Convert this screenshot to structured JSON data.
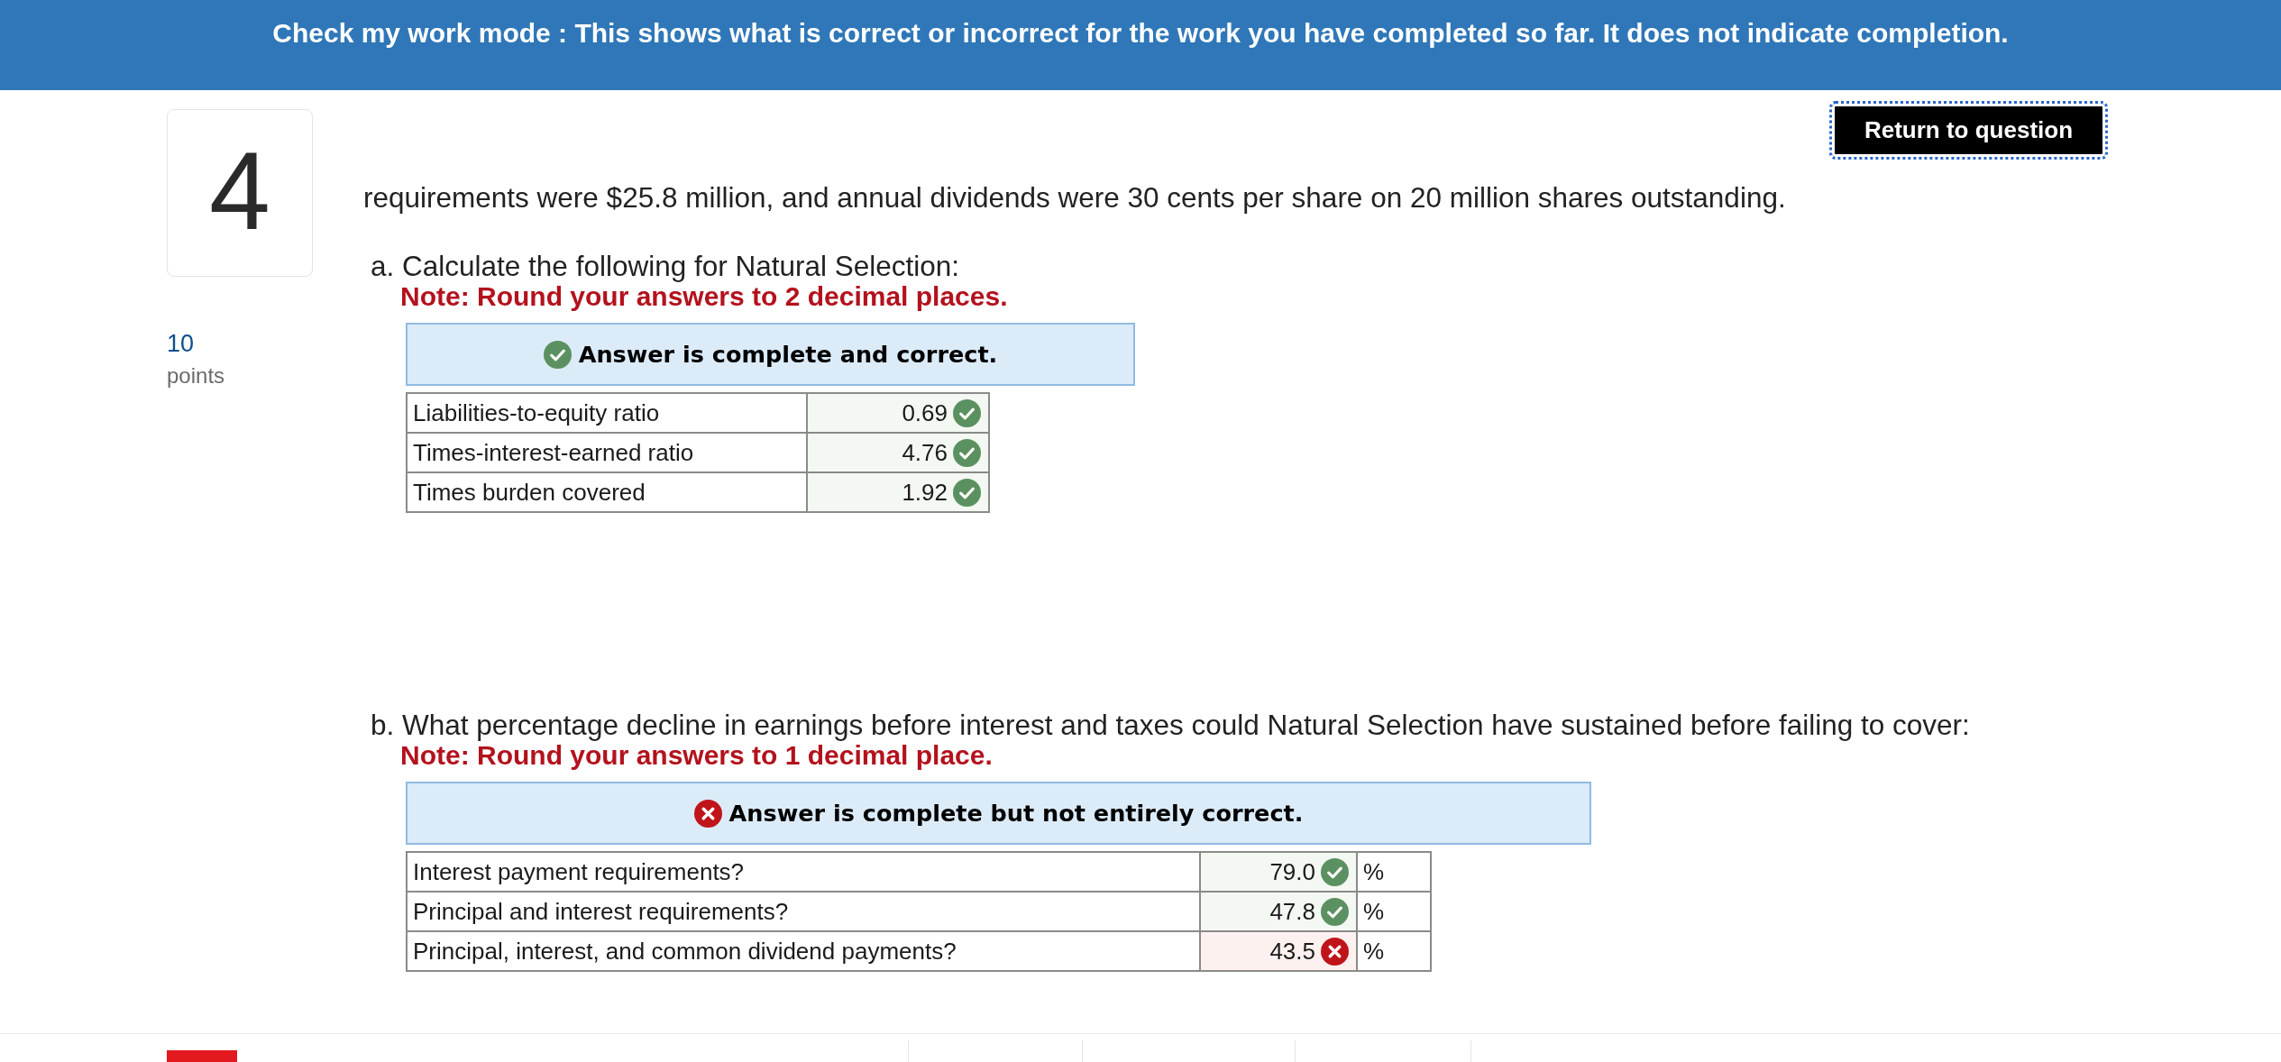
{
  "mode_banner": {
    "text": "Check my work mode : This shows what is correct or incorrect for the work you have completed so far. It does not indicate completion."
  },
  "question": {
    "number": "4",
    "points_value": "10",
    "points_label": "points",
    "return_button": "Return to question",
    "text": "requirements were $25.8 million, and annual dividends were 30 cents per share on 20 million shares outstanding."
  },
  "parts": [
    {
      "prompt": "a. Calculate the following for Natural Selection:",
      "note": "Note: Round your answers to 2 decimal places.",
      "result": {
        "kind": "correct",
        "message": "Answer is complete and correct."
      },
      "rows": [
        {
          "label": "Liabilities-to-equity ratio",
          "value": "0.69",
          "correct": true
        },
        {
          "label": "Times-interest-earned ratio",
          "value": "4.76",
          "correct": true
        },
        {
          "label": "Times burden covered",
          "value": "1.92",
          "correct": true
        }
      ]
    },
    {
      "prompt": "b. What percentage decline in earnings before interest and taxes could Natural Selection have sustained before failing to cover:",
      "note": "Note: Round your answers to 1 decimal place.",
      "result": {
        "kind": "incorrect",
        "message": "Answer is complete but not entirely correct."
      },
      "rows": [
        {
          "label": "Interest payment requirements?",
          "value": "79.0",
          "correct": true,
          "unit": "%"
        },
        {
          "label": "Principal and interest requirements?",
          "value": "47.8",
          "correct": true,
          "unit": "%"
        },
        {
          "label": "Principal, interest, and common dividend payments?",
          "value": "43.5",
          "correct": false,
          "unit": "%"
        }
      ]
    }
  ]
}
